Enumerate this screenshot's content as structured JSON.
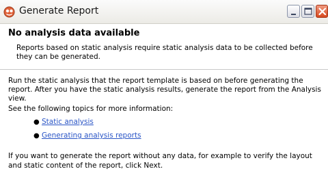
{
  "window": {
    "title": "Generate Report",
    "icon": "report-wizard-icon",
    "controls": [
      "minimize-icon",
      "maximize-icon",
      "close-icon"
    ]
  },
  "header": {
    "title": "No analysis data available",
    "message": "Reports based on static analysis require static analysis data to be collected before they can be generated."
  },
  "body": {
    "paragraph1": "Run the static analysis that the report template is based on before generating the report. After you have the static analysis results, generate the report from the Analysis view.",
    "paragraph2": "See the following topics for more information:",
    "links": [
      {
        "label": "Static analysis"
      },
      {
        "label": "Generating analysis reports"
      }
    ],
    "paragraph3": "If you want to generate the report without any data, for example to verify the layout and static content of the report, click Next."
  },
  "colors": {
    "link": "#2a55c6",
    "close_button": "#d6481e"
  }
}
